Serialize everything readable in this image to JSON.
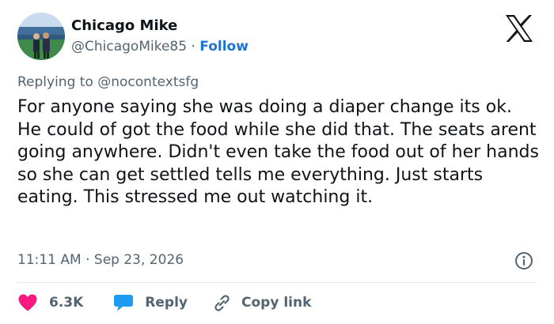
{
  "author": {
    "name": "Chicago Mike",
    "handle": "@ChicagoMike85",
    "separator": "·",
    "follow_label": "Follow",
    "avatar": "profile-photo"
  },
  "platform_logo": "x-logo",
  "reply_context": {
    "prefix": "Replying to",
    "mention": "@nocontextsfg"
  },
  "body": "For anyone saying she was doing a diaper change its ok. He could of got the food while she did that. The seats arent going anywhere. Didn't even take the food out of her hands so she can get settled tells me everything. Just starts eating. This stressed me out watching it.",
  "timestamp": {
    "time": "11:11 AM",
    "separator": "·",
    "date": "Sep 23, 2026"
  },
  "info_icon": "info-icon",
  "actions": {
    "like": {
      "icon": "heart-icon",
      "count": "6.3K",
      "color": "#f91880"
    },
    "reply": {
      "icon": "speech-bubble-icon",
      "label": "Reply",
      "color": "#1d9bf0"
    },
    "copy_link": {
      "icon": "link-icon",
      "label": "Copy link"
    }
  },
  "colors": {
    "text": "#0f1419",
    "secondary": "#536471",
    "link": "#1d74d0",
    "divider": "#e4e8eb"
  }
}
